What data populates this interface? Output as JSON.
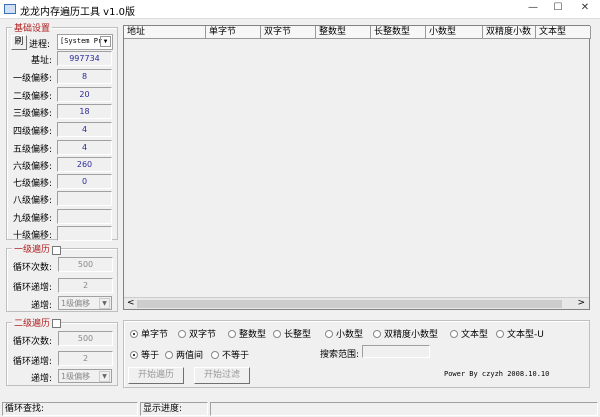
{
  "window": {
    "title": "龙龙内存遍历工具 v1.0版",
    "minimize": "—",
    "maximize": "☐",
    "close": "✕"
  },
  "basic": {
    "legend": "基础设置",
    "refresh": "刷",
    "process_label": "进程:",
    "process_value": "[System Pr",
    "rows": [
      {
        "label": "基址:",
        "value": "997734"
      },
      {
        "label": "一级偏移:",
        "value": "8"
      },
      {
        "label": "二级偏移:",
        "value": "20"
      },
      {
        "label": "三级偏移:",
        "value": "18"
      },
      {
        "label": "四级偏移:",
        "value": "4"
      },
      {
        "label": "五级偏移:",
        "value": "4"
      },
      {
        "label": "六级偏移:",
        "value": "260"
      },
      {
        "label": "七级偏移:",
        "value": "0"
      },
      {
        "label": "八级偏移:",
        "value": ""
      },
      {
        "label": "九级偏移:",
        "value": ""
      },
      {
        "label": "十级偏移:",
        "value": ""
      }
    ]
  },
  "loop1": {
    "legend": "一级遍历",
    "count_label": "循环次数:",
    "count": "500",
    "inc_label": "循环递增:",
    "inc": "2",
    "step_label": "递增:",
    "step": "1级偏移"
  },
  "loop2": {
    "legend": "二级遍历",
    "count_label": "循环次数:",
    "count": "500",
    "inc_label": "循环递增:",
    "inc": "2",
    "step_label": "递增:",
    "step": "1级偏移"
  },
  "list": {
    "columns": [
      "地址",
      "单字节",
      "双字节",
      "整数型",
      "长整数型",
      "小数型",
      "双精度小数",
      "文本型"
    ],
    "scroll_left": "<",
    "scroll_right": ">"
  },
  "types": [
    "单字节",
    "双字节",
    "整数型",
    "长整型",
    "小数型",
    "双精度小数型",
    "文本型",
    "文本型-U"
  ],
  "compare": [
    "等于",
    "两值间",
    "不等于"
  ],
  "search_range_label": "搜索范围:",
  "start_traverse": "开始遍历",
  "start_filter": "开始过滤",
  "credit": "Power By czyzh 2008.10.10",
  "statusbar": {
    "loop_find": "循环查找:",
    "progress": "显示进度:"
  }
}
